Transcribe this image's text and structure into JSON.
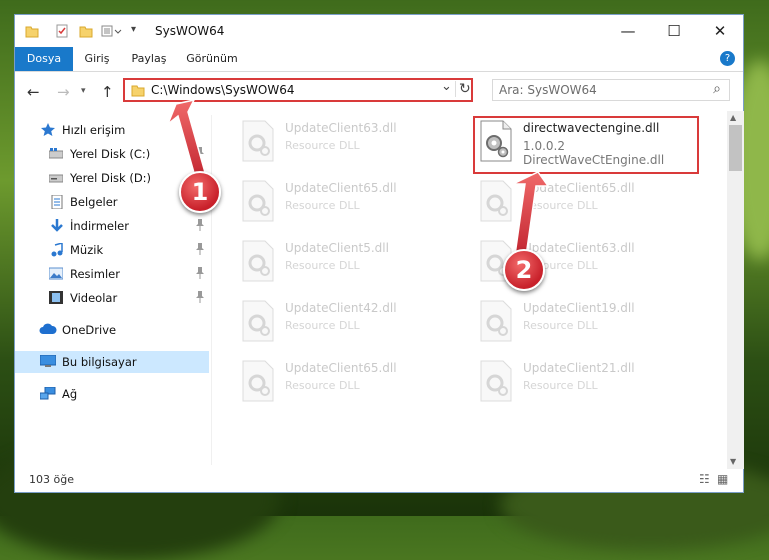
{
  "window": {
    "title": "SysWOW64",
    "min_glyph": "—",
    "max_glyph": "☐",
    "close_glyph": "✕"
  },
  "ribbon": {
    "tabs": [
      "Dosya",
      "Giriş",
      "Paylaş",
      "Görünüm"
    ],
    "help_glyph": "?"
  },
  "nav": {
    "back_glyph": "←",
    "forward_glyph": "→",
    "up_glyph": "↑",
    "address": "C:\\Windows\\SysWOW64",
    "dropdown_glyph": "⌄",
    "refresh_glyph": "↻",
    "search_placeholder": "Ara: SysWOW64",
    "search_glyph": "⌕"
  },
  "sidebar": {
    "items": [
      {
        "label": "Hızlı erişim",
        "icon": "star-icon",
        "pinned": false
      },
      {
        "label": "Yerel Disk (C:)",
        "icon": "drive-icon",
        "pinned": true
      },
      {
        "label": "Yerel Disk (D:)",
        "icon": "drive-icon",
        "pinned": false
      },
      {
        "label": "Belgeler",
        "icon": "documents-icon",
        "pinned": true
      },
      {
        "label": "İndirmeler",
        "icon": "download-icon",
        "pinned": true
      },
      {
        "label": "Müzik",
        "icon": "music-icon",
        "pinned": true
      },
      {
        "label": "Resimler",
        "icon": "pictures-icon",
        "pinned": true
      },
      {
        "label": "Videolar",
        "icon": "videos-icon",
        "pinned": true
      },
      {
        "label": "OneDrive",
        "icon": "cloud-icon",
        "pinned": false
      },
      {
        "label": "Bu bilgisayar",
        "icon": "computer-icon",
        "pinned": false,
        "selected": true
      },
      {
        "label": "Ağ",
        "icon": "network-icon",
        "pinned": false
      }
    ],
    "pin_glyph": "📌"
  },
  "files": {
    "left": [
      {
        "name": "UpdateClient63.dll",
        "type": "Resource DLL"
      },
      {
        "name": "UpdateClient65.dll",
        "type": "Resource DLL"
      },
      {
        "name": "UpdateClient5.dll",
        "type": "Resource DLL"
      },
      {
        "name": "UpdateClient42.dll",
        "type": "Resource DLL"
      },
      {
        "name": "UpdateClient65.dll",
        "type": "Resource DLL"
      }
    ],
    "highlighted": {
      "name": "directwavectengine.dll",
      "version": "1.0.0.2",
      "description": "DirectWaveCtEngine.dll"
    },
    "right": [
      {
        "name": "UpdateClient65.dll",
        "type": "Resource DLL"
      },
      {
        "name": "UpdateClient63.dll",
        "type": "Resource DLL"
      },
      {
        "name": "UpdateClient19.dll",
        "type": "Resource DLL"
      },
      {
        "name": "UpdateClient21.dll",
        "type": "Resource DLL"
      }
    ]
  },
  "status": {
    "count": "103 öğe"
  },
  "annotations": {
    "badge1": "1",
    "badge2": "2",
    "color": "#d93a3a"
  }
}
